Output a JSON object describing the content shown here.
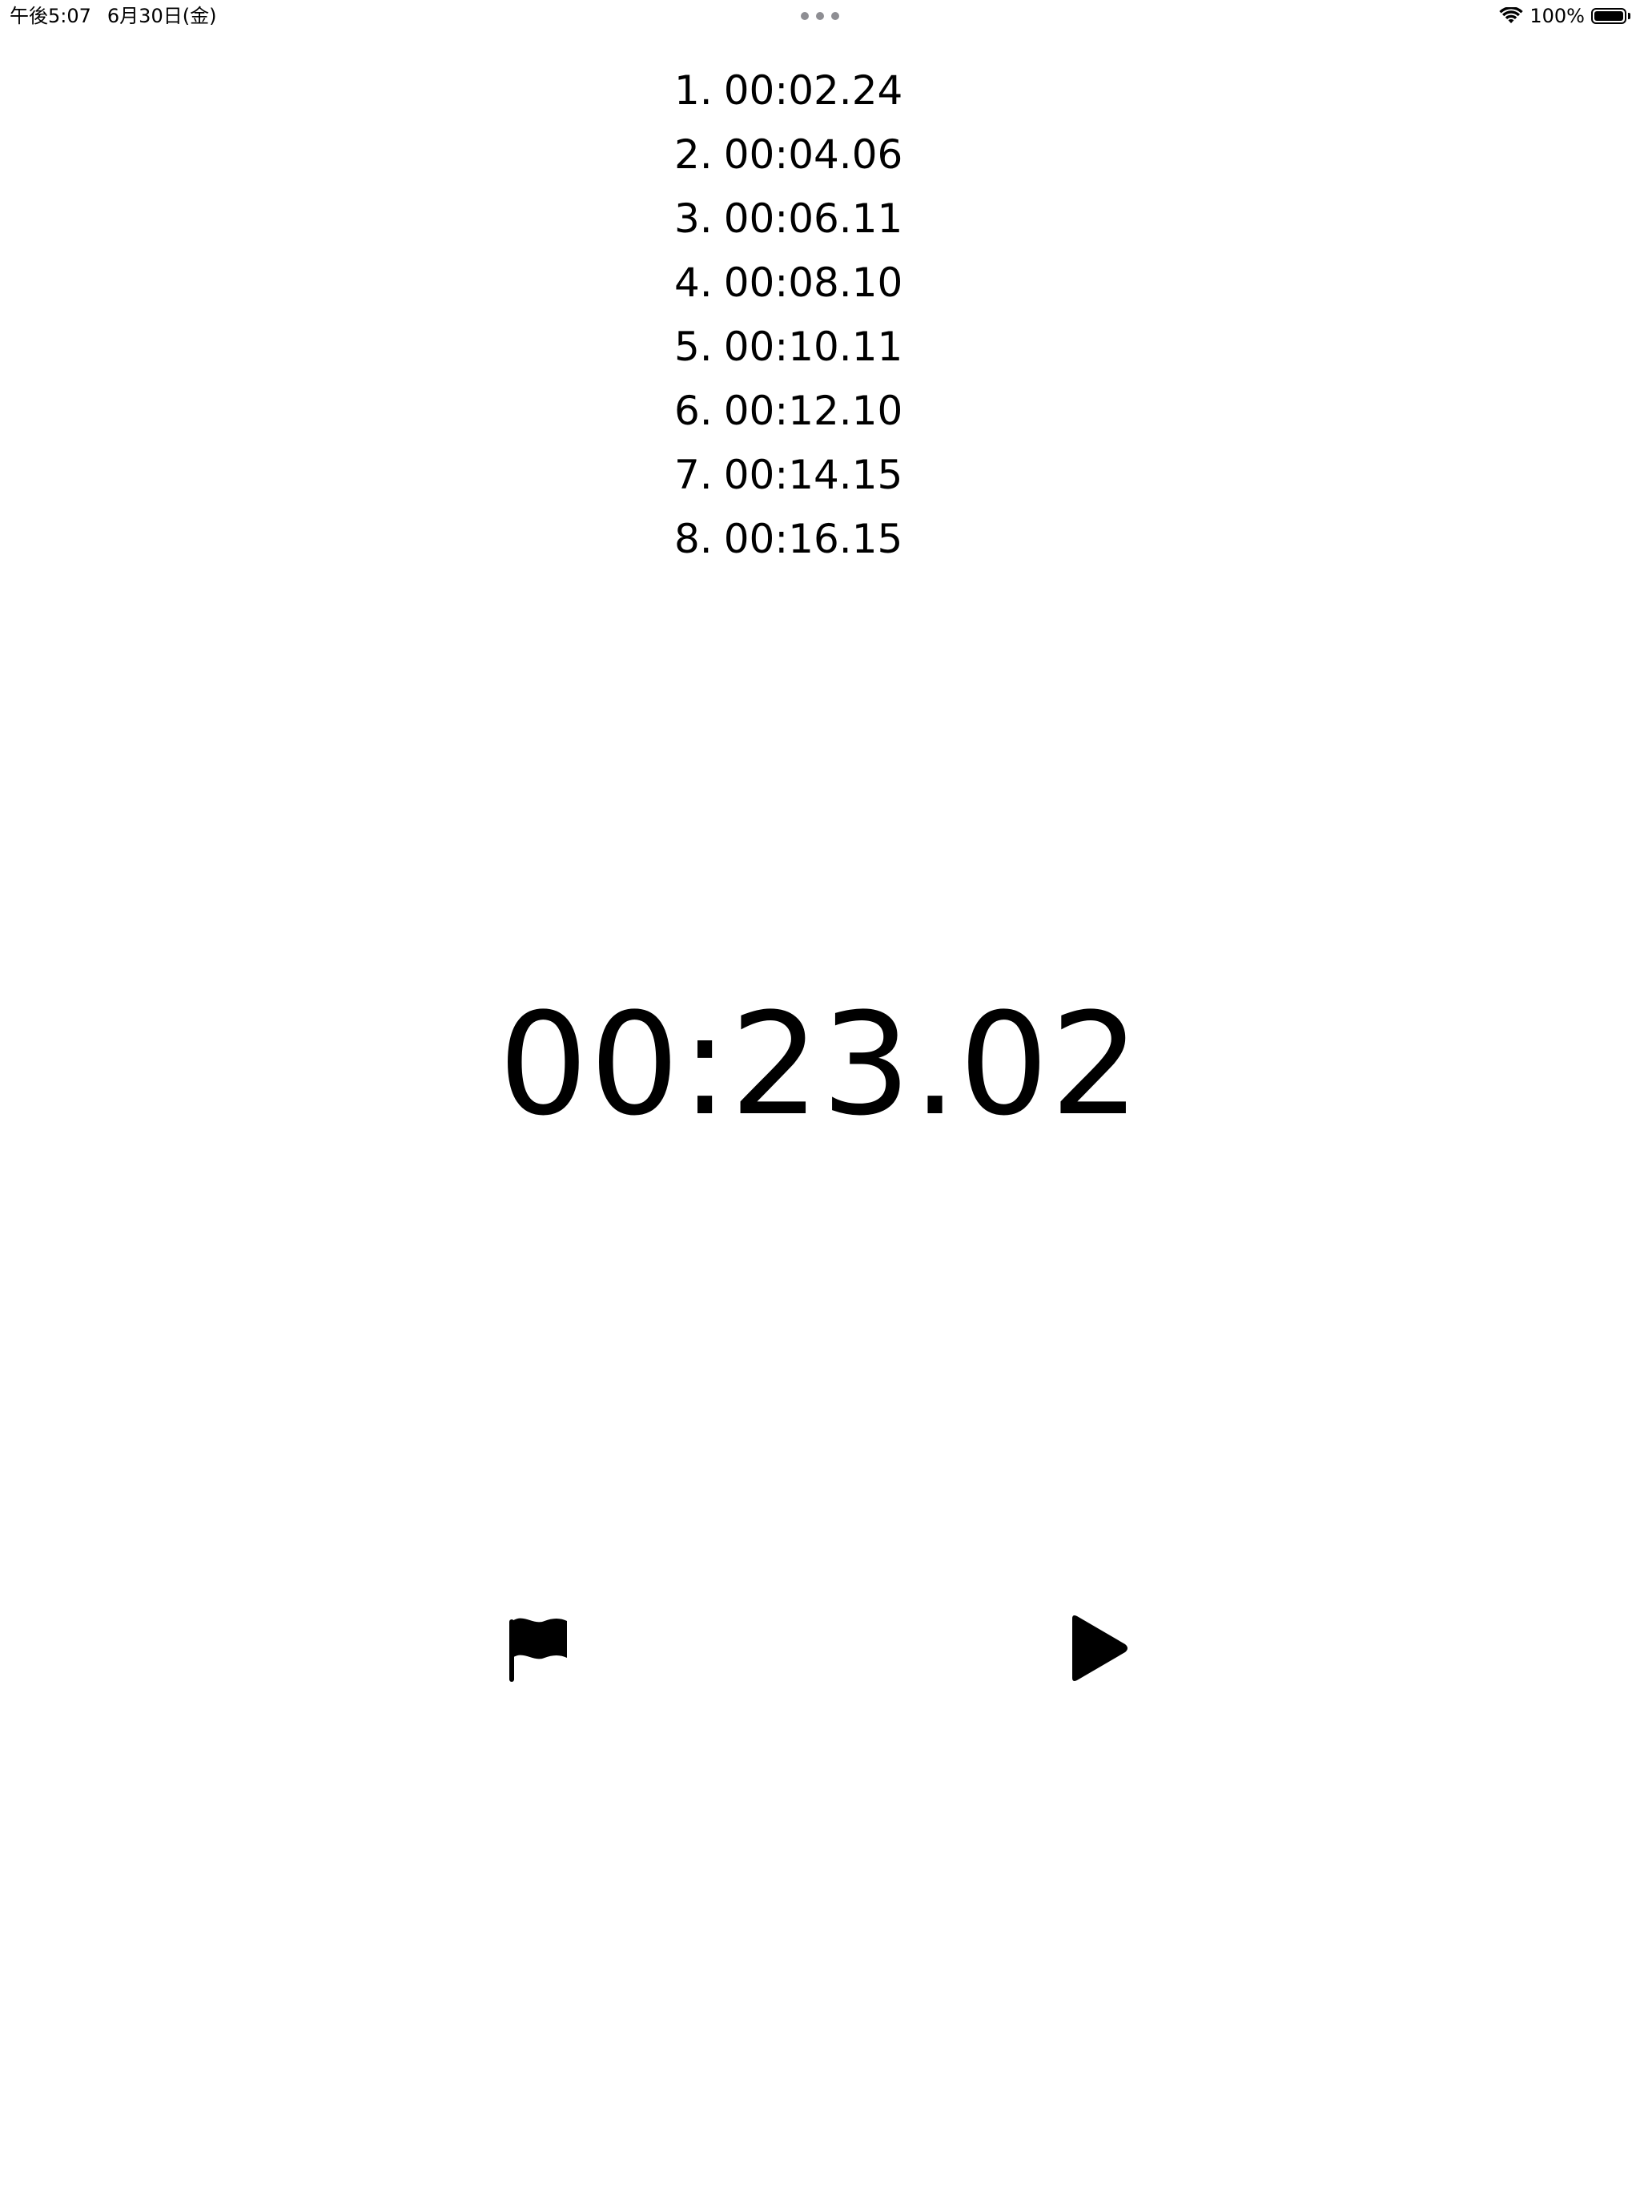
{
  "status_bar": {
    "time": "午後5:07",
    "date": "6月30日(金)",
    "battery_text": "100%",
    "battery_level": 1.0
  },
  "laps": [
    {
      "number": "1.",
      "time": "00:02.24"
    },
    {
      "number": "2.",
      "time": "00:04.06"
    },
    {
      "number": "3.",
      "time": "00:06.11"
    },
    {
      "number": "4.",
      "time": "00:08.10"
    },
    {
      "number": "5.",
      "time": "00:10.11"
    },
    {
      "number": "6.",
      "time": "00:12.10"
    },
    {
      "number": "7.",
      "time": "00:14.15"
    },
    {
      "number": "8.",
      "time": "00:16.15"
    }
  ],
  "timer": {
    "display": "00:23.02"
  },
  "controls": {
    "lap_icon": "flag-icon",
    "play_icon": "play-icon"
  },
  "colors": {
    "background": "#ffffff",
    "foreground": "#000000",
    "dots": "#8e8e93"
  }
}
